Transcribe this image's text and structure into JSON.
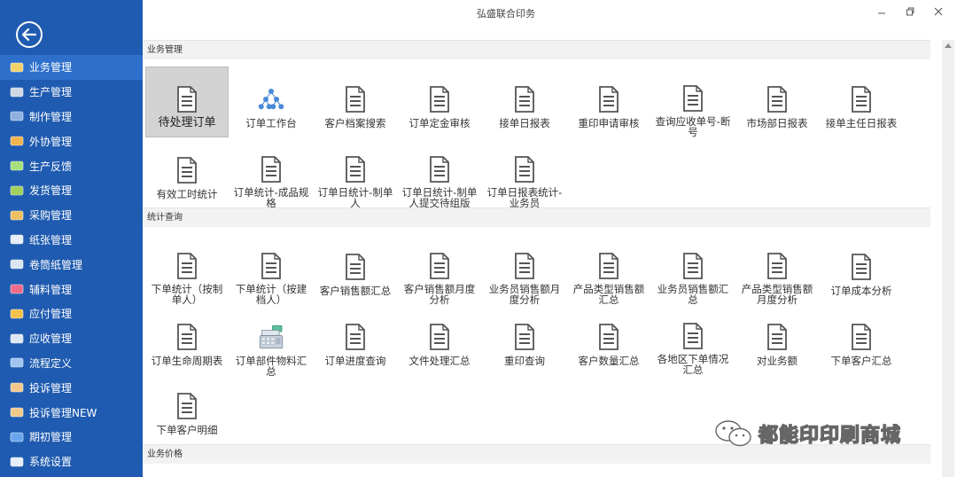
{
  "window": {
    "title": "弘盛联合印务"
  },
  "sidebar": {
    "items": [
      {
        "label": "业务管理",
        "icon": "clipboard-check-icon",
        "active": true
      },
      {
        "label": "生产管理",
        "icon": "truck-icon"
      },
      {
        "label": "制作管理",
        "icon": "list-icon"
      },
      {
        "label": "外协管理",
        "icon": "delivery-truck-icon"
      },
      {
        "label": "生产反馈",
        "icon": "bar-chart-icon"
      },
      {
        "label": "发货管理",
        "icon": "package-truck-icon"
      },
      {
        "label": "采购管理",
        "icon": "cart-icon"
      },
      {
        "label": "纸张管理",
        "icon": "paper-stack-icon"
      },
      {
        "label": "卷筒纸管理",
        "icon": "paper-roll-icon"
      },
      {
        "label": "辅料管理",
        "icon": "eraser-icon"
      },
      {
        "label": "应付管理",
        "icon": "coins-icon"
      },
      {
        "label": "应收管理",
        "icon": "cash-register-icon"
      },
      {
        "label": "流程定义",
        "icon": "flow-icon"
      },
      {
        "label": "投诉管理",
        "icon": "person-icon"
      },
      {
        "label": "投诉管理NEW",
        "icon": "person-icon"
      },
      {
        "label": "期初管理",
        "icon": "counter-icon"
      },
      {
        "label": "系统设置",
        "icon": "gears-icon"
      }
    ]
  },
  "sections": [
    {
      "title": "业务管理",
      "rows": [
        [
          {
            "label": "待处理订单",
            "icon": "document-icon",
            "selected": true
          },
          {
            "label": "订单工作台",
            "icon": "org-tree-icon"
          },
          {
            "label": "客户档案搜索",
            "icon": "document-icon"
          },
          {
            "label": "订单定金审核",
            "icon": "document-icon"
          },
          {
            "label": "接单日报表",
            "icon": "document-icon"
          },
          {
            "label": "重印申请审核",
            "icon": "document-icon"
          },
          {
            "label": "查询应收单号-断号",
            "icon": "document-icon"
          },
          {
            "label": "市场部日报表",
            "icon": "document-icon"
          },
          {
            "label": "接单主任日报表",
            "icon": "document-icon"
          }
        ],
        [
          {
            "label": "有效工时统计",
            "icon": "document-icon"
          },
          {
            "label": "订单统计-成品规格",
            "icon": "document-icon"
          },
          {
            "label": "订单日统计-制单人",
            "icon": "document-icon"
          },
          {
            "label": "订单日统计-制单人提交待组版",
            "icon": "document-icon"
          },
          {
            "label": "订单日报表统计-业务员",
            "icon": "document-icon"
          }
        ]
      ]
    },
    {
      "title": "统计查询",
      "rows": [
        [
          {
            "label": "下单统计（按制单人）",
            "icon": "document-icon"
          },
          {
            "label": "下单统计（按建档人）",
            "icon": "document-icon"
          },
          {
            "label": "客户销售额汇总",
            "icon": "document-icon"
          },
          {
            "label": "客户销售额月度分析",
            "icon": "document-icon"
          },
          {
            "label": "业务员销售额月度分析",
            "icon": "document-icon"
          },
          {
            "label": "产品类型销售额汇总",
            "icon": "document-icon"
          },
          {
            "label": "业务员销售额汇总",
            "icon": "document-icon"
          },
          {
            "label": "产品类型销售额月度分析",
            "icon": "document-icon"
          },
          {
            "label": "订单成本分析",
            "icon": "document-icon"
          }
        ],
        [
          {
            "label": "订单生命周期表",
            "icon": "document-icon"
          },
          {
            "label": "订单部件物料汇总",
            "icon": "cash-register-icon"
          },
          {
            "label": "订单进度查询",
            "icon": "document-icon"
          },
          {
            "label": "文件处理汇总",
            "icon": "document-icon"
          },
          {
            "label": "重印查询",
            "icon": "document-icon"
          },
          {
            "label": "客户数量汇总",
            "icon": "document-icon"
          },
          {
            "label": "各地区下单情况汇总",
            "icon": "document-icon"
          },
          {
            "label": "对业务额",
            "icon": "document-icon"
          },
          {
            "label": "下单客户汇总",
            "icon": "document-icon"
          }
        ],
        [
          {
            "label": "下单客户明细",
            "icon": "document-icon"
          }
        ]
      ]
    },
    {
      "title": "业务价格",
      "rows": []
    }
  ],
  "watermark": {
    "text": "都能印印刷商城",
    "icon": "wechat-icon"
  },
  "colors": {
    "sidebar": "#1f5bb0",
    "sidebar_active": "#2d6fcb",
    "section_bg": "#f2f2f2",
    "selected_tile": "#d3d3d3"
  }
}
